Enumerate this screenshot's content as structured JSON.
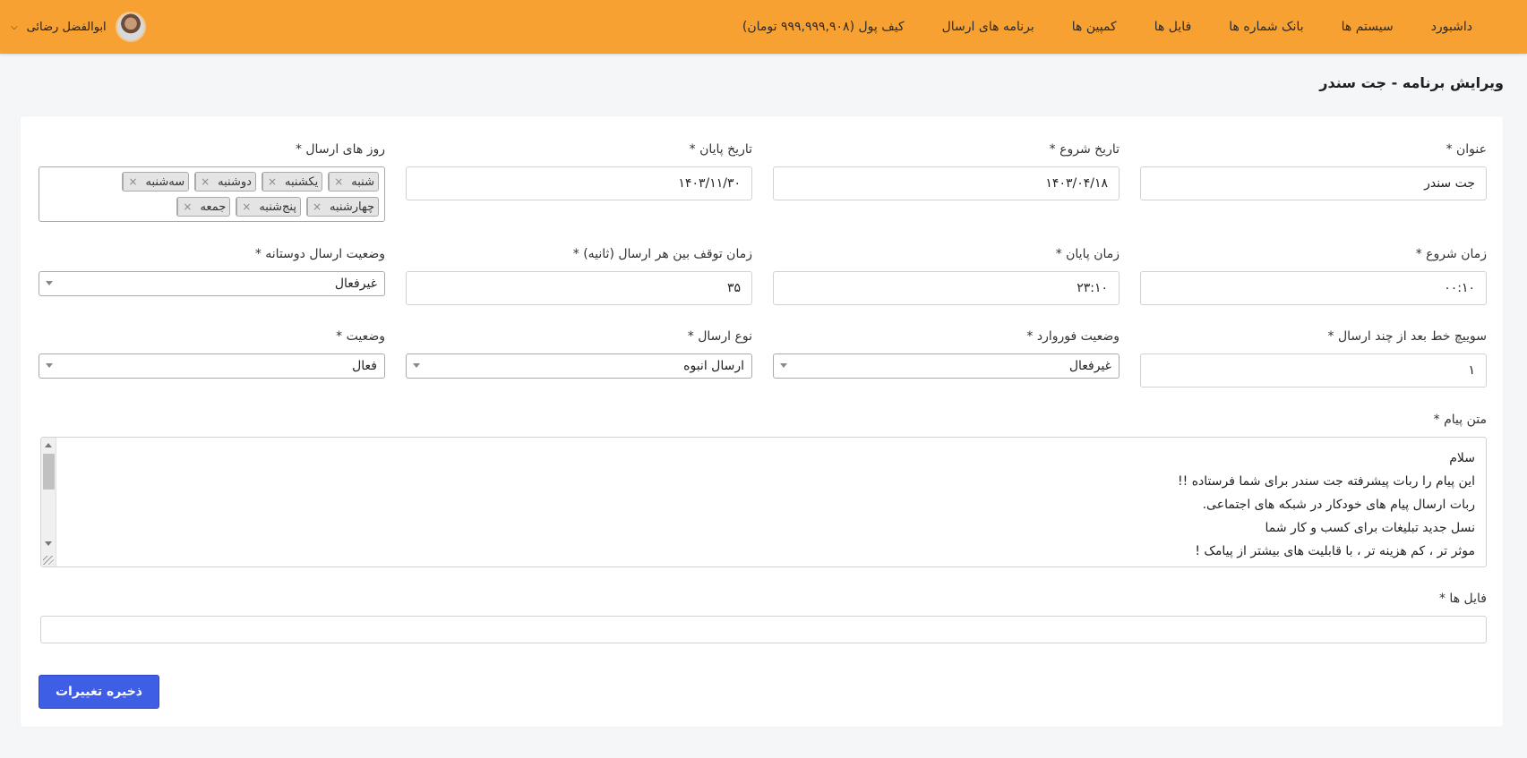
{
  "header": {
    "nav": [
      "داشبورد",
      "سیستم ها",
      "بانک شماره ها",
      "فایل ها",
      "کمپین ها",
      "برنامه های ارسال",
      "کیف پول (۹۹۹,۹۹۹,۹۰۸ تومان)"
    ],
    "user_name": "ابوالفضل رضائی",
    "bar_color": "#f6a131"
  },
  "page_title": "ویرایش برنامه - جت سندر",
  "form": {
    "title": {
      "label": "عنوان *",
      "value": "جت سندر"
    },
    "start_date": {
      "label": "تاریخ شروع *",
      "value": "۱۴۰۳/۰۴/۱۸"
    },
    "end_date": {
      "label": "تاریخ پایان *",
      "value": "۱۴۰۳/۱۱/۳۰"
    },
    "send_days": {
      "label": "روز های ارسال *",
      "tags": [
        "شنبه",
        "یکشنبه",
        "دوشنبه",
        "سه‌شنبه",
        "چهارشنبه",
        "پنج‌شنبه",
        "جمعه"
      ]
    },
    "start_time": {
      "label": "زمان شروع *",
      "value": "۰۰:۱۰"
    },
    "end_time": {
      "label": "زمان پایان *",
      "value": "۲۳:۱۰"
    },
    "pause_time": {
      "label": "زمان توقف بین هر ارسال (ثانیه) *",
      "value": "۳۵"
    },
    "friendly_status": {
      "label": "وضعیت ارسال دوستانه *",
      "value": "غیرفعال"
    },
    "line_switch": {
      "label": "سوییچ خط بعد از چند ارسال *",
      "value": "۱"
    },
    "forward_status": {
      "label": "وضعیت فوروارد *",
      "value": "غیرفعال"
    },
    "send_type": {
      "label": "نوع ارسال *",
      "value": "ارسال انبوه"
    },
    "status": {
      "label": "وضعیت *",
      "value": "فعال"
    },
    "message": {
      "label": "متن پیام *",
      "lines": [
        "سلام",
        "این پیام را ربات پیشرفته جت سندر برای شما فرستاده !!",
        "ربات ارسال پیام های خودکار در شبکه های اجتماعی.",
        "نسل جدید تبلیغات برای کسب و کار شما",
        "موثر تر ، کم هزینه تر ، با قابلیت های بیشتر از پیامک !"
      ]
    },
    "files": {
      "label": "فایل ها *"
    },
    "save_label": "ذخیره تغییرات"
  }
}
